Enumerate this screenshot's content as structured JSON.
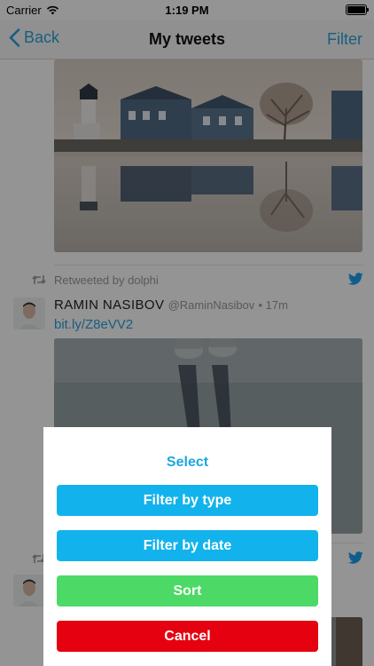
{
  "status_bar": {
    "carrier": "Carrier",
    "time": "1:19 PM"
  },
  "nav": {
    "back_label": "Back",
    "title": "My tweets",
    "filter_label": "Filter"
  },
  "feed": {
    "retweets": [
      {
        "retweet_label": "Retweeted by dolphi",
        "author_name": "RAMIN NASIBOV",
        "author_handle": "@RaminNasibov",
        "meta": "• 17m",
        "link": "bit.ly/Z8eVV2"
      }
    ]
  },
  "sheet": {
    "title": "Select",
    "buttons": [
      {
        "label": "Filter by type",
        "color": "#12b3ec"
      },
      {
        "label": "Filter by date",
        "color": "#12b3ec"
      },
      {
        "label": "Sort",
        "color": "#4cd965"
      },
      {
        "label": "Cancel",
        "color": "#e5010f"
      }
    ]
  },
  "colors": {
    "accent": "#2aa3dd",
    "twitter_blue": "#1da1f2"
  }
}
